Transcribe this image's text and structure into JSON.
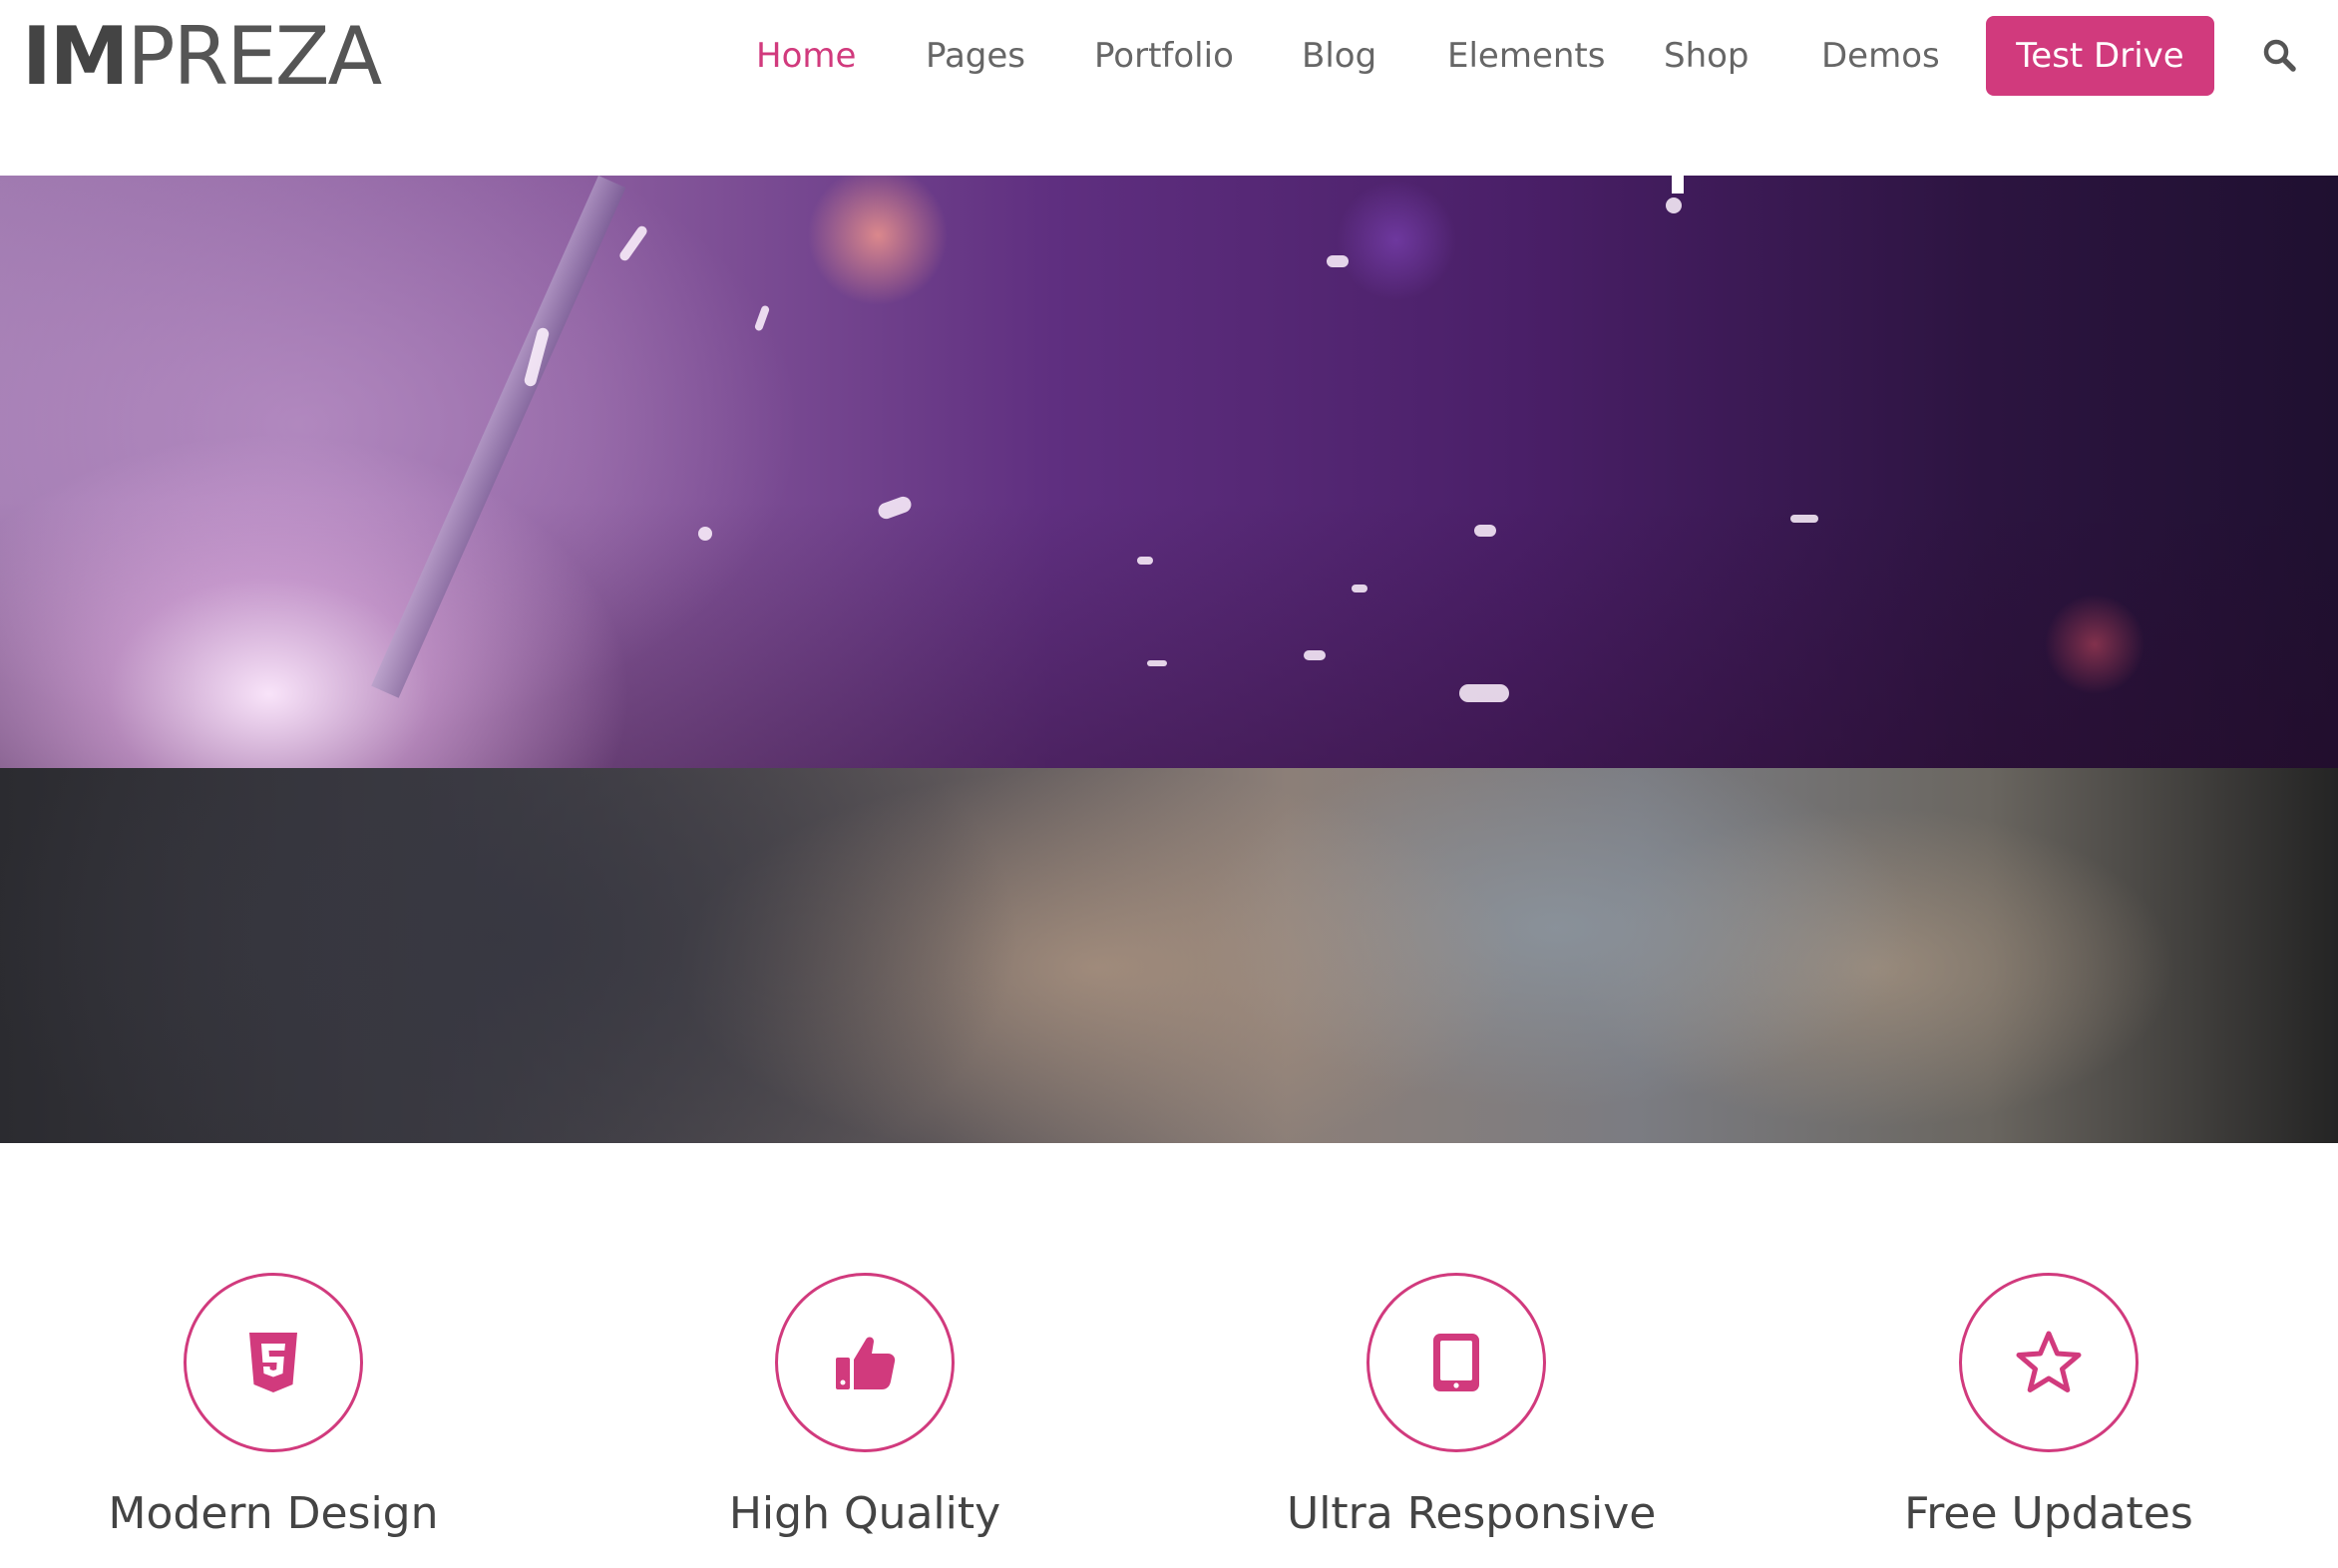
{
  "brand": {
    "logo_bold": "IM",
    "logo_light": "PREZA"
  },
  "nav": {
    "items": [
      {
        "label": "Home",
        "active": true
      },
      {
        "label": "Pages"
      },
      {
        "label": "Portfolio"
      },
      {
        "label": "Blog"
      },
      {
        "label": "Elements"
      },
      {
        "label": "Shop"
      },
      {
        "label": "Demos"
      }
    ],
    "cta_label": "Test Drive",
    "search_icon": "search-icon"
  },
  "colors": {
    "accent": "#d13a7d",
    "text": "#666666",
    "heading": "#444444"
  },
  "features": [
    {
      "icon": "html5-icon",
      "title": "Modern Design"
    },
    {
      "icon": "thumbs-up-icon",
      "title": "High Quality"
    },
    {
      "icon": "tablet-icon",
      "title": "Ultra Responsive"
    },
    {
      "icon": "star-icon",
      "title": "Free Updates"
    }
  ]
}
